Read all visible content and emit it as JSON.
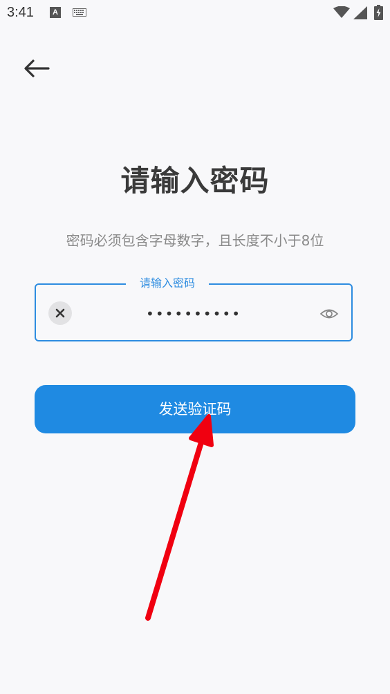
{
  "status_bar": {
    "time": "3:41",
    "a_badge": "A",
    "icons": [
      "a-badge-icon",
      "keyboard-icon",
      "wifi-icon",
      "signal-icon",
      "battery-charging-icon"
    ]
  },
  "nav": {
    "back_icon": "arrow-left-icon"
  },
  "page": {
    "title": "请输入密码",
    "hint": "密码必须包含字母数字，且长度不小于8位"
  },
  "password_field": {
    "label": "请输入密码",
    "value": "••••••••••",
    "clear_icon": "close-icon",
    "visibility_icon": "eye-icon"
  },
  "actions": {
    "send_code_label": "发送验证码"
  },
  "colors": {
    "accent": "#1f8ae2",
    "field_border": "#2d8ce0",
    "annotation": "#f00010",
    "background": "#f8f8fa"
  }
}
